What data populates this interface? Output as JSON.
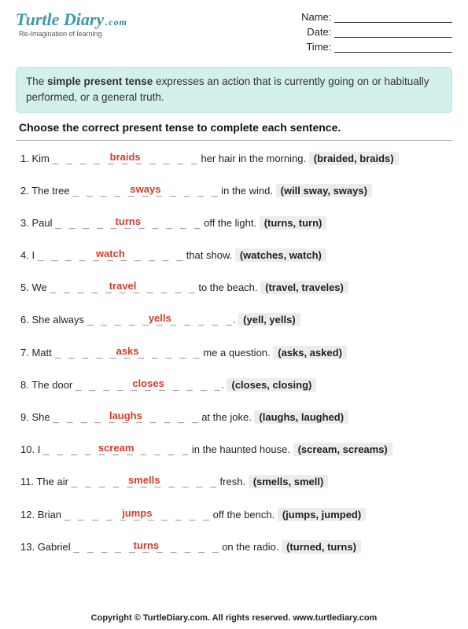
{
  "logo": {
    "main": "Turtle Diary",
    "sub": ".com",
    "tagline": "Re-Imagination of learning"
  },
  "header_fields": {
    "name": "Name:",
    "date": "Date:",
    "time": "Time:"
  },
  "info_html": "The <b>simple present tense</b> expresses an action that is currently going on or habitually performed, or a general truth.",
  "instructions": "Choose the correct present tense to complete each sentence.",
  "blank_pattern": "_ _ _ _ _ _ _ _ _ _ _",
  "questions": [
    {
      "n": "1.",
      "pre": "Kim ",
      "ans": "braids",
      "post": " her hair in the morning.  ",
      "opts": "(braided, braids)"
    },
    {
      "n": "2.",
      "pre": "The tree ",
      "ans": "sways",
      "post": " in the wind.  ",
      "opts": "(will sway, sways)"
    },
    {
      "n": "3.",
      "pre": "Paul ",
      "ans": "turns",
      "post": " off the light.  ",
      "opts": "(turns, turn)"
    },
    {
      "n": "4.",
      "pre": "I ",
      "ans": "watch",
      "post": " that show.  ",
      "opts": "(watches, watch)"
    },
    {
      "n": "5.",
      "pre": "We ",
      "ans": "travel",
      "post": " to the beach.  ",
      "opts": "(travel, traveles)"
    },
    {
      "n": "6.",
      "pre": "She always ",
      "ans": "yells",
      "post": ".  ",
      "opts": "(yell, yells)"
    },
    {
      "n": "7.",
      "pre": "Matt ",
      "ans": "asks",
      "post": " me a question.  ",
      "opts": "(asks, asked)"
    },
    {
      "n": "8.",
      "pre": "The door ",
      "ans": "closes",
      "post": ".  ",
      "opts": "(closes, closing)"
    },
    {
      "n": "9.",
      "pre": "She ",
      "ans": "laughs",
      "post": " at the joke.  ",
      "opts": "(laughs, laughed)"
    },
    {
      "n": "10.",
      "pre": "I ",
      "ans": "scream",
      "post": " in the haunted house.  ",
      "opts": "(scream, screams)"
    },
    {
      "n": "11.",
      "pre": "The air ",
      "ans": "smells",
      "post": " fresh.  ",
      "opts": "(smells, smell)"
    },
    {
      "n": "12.",
      "pre": "Brian ",
      "ans": "jumps",
      "post": " off the bench.  ",
      "opts": "(jumps, jumped)"
    },
    {
      "n": "13.",
      "pre": "Gabriel ",
      "ans": "turns",
      "post": " on the radio.  ",
      "opts": "(turned, turns)"
    }
  ],
  "footer": "Copyright © TurtleDiary.com. All rights reserved. www.turtlediary.com"
}
